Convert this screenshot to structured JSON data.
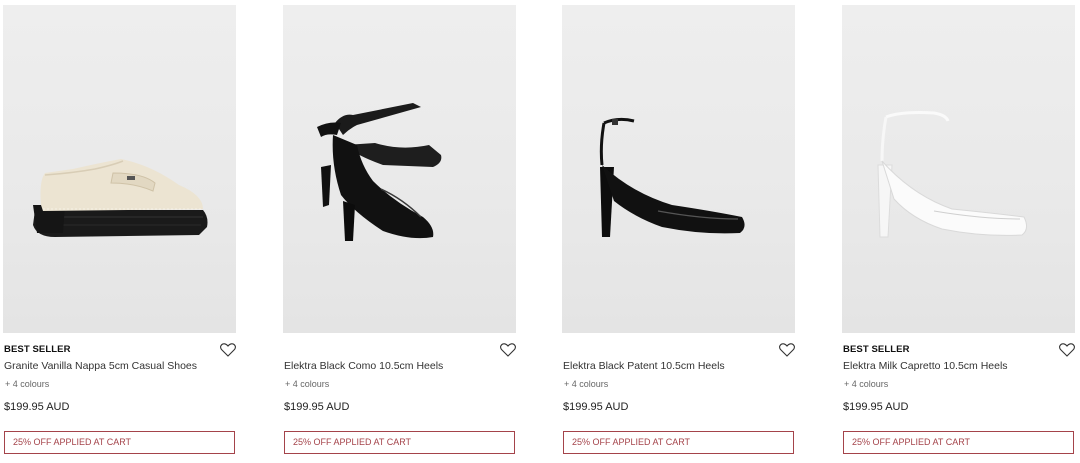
{
  "products": [
    {
      "badge": "BEST SELLER",
      "name": "Granite Vanilla Nappa 5cm Casual Shoes",
      "colours": "+ 4 colours",
      "price": "$199.95 AUD",
      "promo": "25% OFF APPLIED AT CART",
      "image_icon": "loafer-image"
    },
    {
      "badge": "",
      "name": "Elektra Black Como 10.5cm Heels",
      "colours": "+ 4 colours",
      "price": "$199.95 AUD",
      "promo": "25% OFF APPLIED AT CART",
      "image_icon": "heels-pair-image"
    },
    {
      "badge": "",
      "name": "Elektra Black Patent 10.5cm Heels",
      "colours": "+ 4 colours",
      "price": "$199.95 AUD",
      "promo": "25% OFF APPLIED AT CART",
      "image_icon": "heel-image"
    },
    {
      "badge": "BEST SELLER",
      "name": "Elektra Milk Capretto 10.5cm Heels",
      "colours": "+ 4 colours",
      "price": "$199.95 AUD",
      "promo": "25% OFF APPLIED AT CART",
      "image_icon": "heel-image"
    }
  ],
  "colors": {
    "promo_border": "#a4434a",
    "image_bg": "#ececec"
  }
}
